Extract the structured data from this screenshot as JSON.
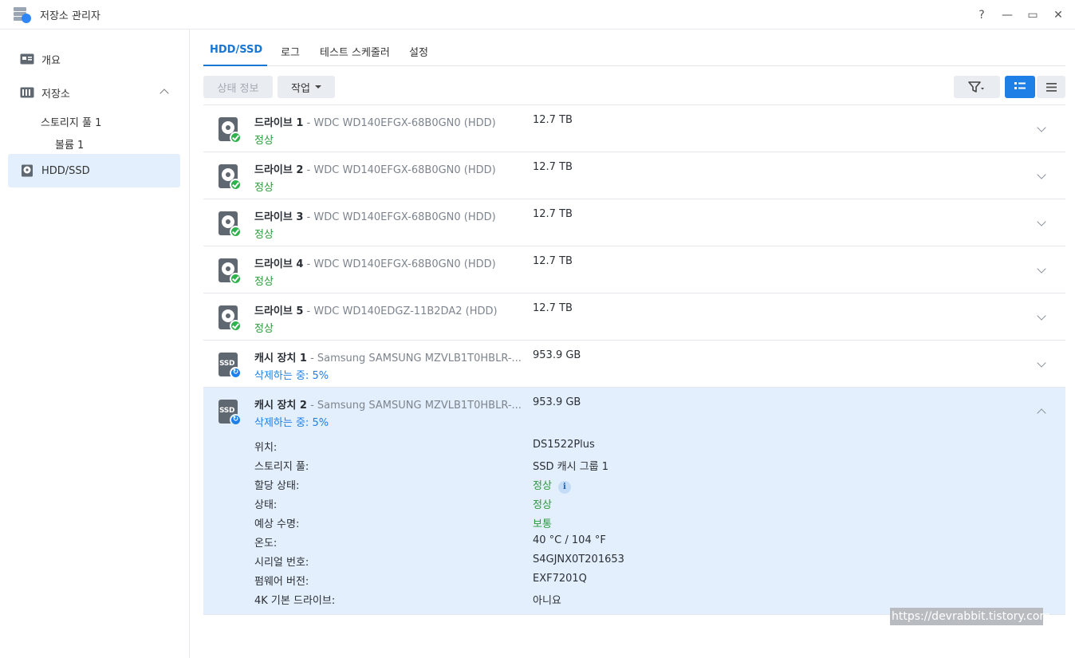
{
  "window": {
    "title": "저장소 관리자",
    "controls": {
      "help": "?",
      "minimize": "—",
      "maximize": "▭",
      "close": "✕"
    }
  },
  "sidebar": {
    "overview": "개요",
    "storage": "저장소",
    "storage_pool": "스토리지 풀 1",
    "volume": "볼륨 1",
    "hdd_ssd": "HDD/SSD"
  },
  "tabs": [
    "HDD/SSD",
    "로그",
    "테스트 스케줄러",
    "설정"
  ],
  "toolbar": {
    "status_info": "상태 정보",
    "action": "작업"
  },
  "drives": [
    {
      "name": "드라이브 1",
      "model": "WDC WD140EFGX-68B0GN0 (HDD)",
      "capacity": "12.7 TB",
      "status": "정상",
      "type": "hdd"
    },
    {
      "name": "드라이브 2",
      "model": "WDC WD140EFGX-68B0GN0 (HDD)",
      "capacity": "12.7 TB",
      "status": "정상",
      "type": "hdd"
    },
    {
      "name": "드라이브 3",
      "model": "WDC WD140EFGX-68B0GN0 (HDD)",
      "capacity": "12.7 TB",
      "status": "정상",
      "type": "hdd"
    },
    {
      "name": "드라이브 4",
      "model": "WDC WD140EFGX-68B0GN0 (HDD)",
      "capacity": "12.7 TB",
      "status": "정상",
      "type": "hdd"
    },
    {
      "name": "드라이브 5",
      "model": "WDC WD140EDGZ-11B2DA2 (HDD)",
      "capacity": "12.7 TB",
      "status": "정상",
      "type": "hdd"
    },
    {
      "name": "캐시 장치 1",
      "model": "Samsung SAMSUNG MZVLB1T0HBLR-...",
      "capacity": "953.9 GB",
      "status": "삭제하는 중: 5%",
      "type": "ssd"
    },
    {
      "name": "캐시 장치 2",
      "model": "Samsung SAMSUNG MZVLB1T0HBLR-...",
      "capacity": "953.9 GB",
      "status": "삭제하는 중: 5%",
      "type": "ssd"
    }
  ],
  "ssd_icon_label": "SSD",
  "details": [
    {
      "key": "위치:",
      "value": "DS1522Plus"
    },
    {
      "key": "스토리지 풀:",
      "value": "SSD 캐시 그룹 1"
    },
    {
      "key": "할당 상태:",
      "value": "정상"
    },
    {
      "key": "상태:",
      "value": "정상"
    },
    {
      "key": "예상 수명:",
      "value": "보통"
    },
    {
      "key": "온도:",
      "value": "40 °C / 104 °F"
    },
    {
      "key": "시리얼 번호:",
      "value": "S4GJNX0T201653"
    },
    {
      "key": "펌웨어 버전:",
      "value": "EXF7201Q"
    },
    {
      "key": "4K 기본 드라이브:",
      "value": "아니요"
    }
  ],
  "watermark": "https://devrabbit.tistory.com",
  "colors": {
    "accent": "#1976d2",
    "ok": "#2a9a3a",
    "info": "#1e7fe6",
    "selected_bg": "#e3effc"
  }
}
